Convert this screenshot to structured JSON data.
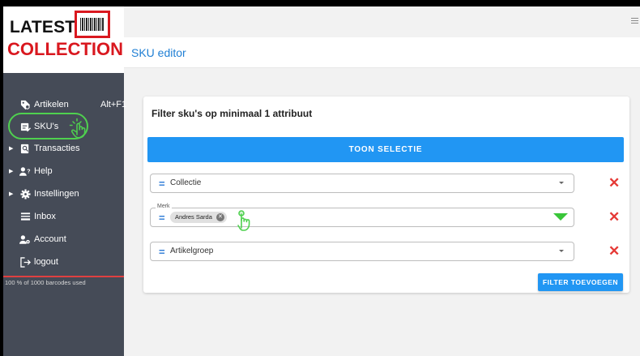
{
  "logo": {
    "line1": "LATEST",
    "line2": "COLLECTION"
  },
  "header": {
    "page_title": "SKU editor"
  },
  "sidebar": {
    "items": [
      {
        "label": "Artikelen",
        "shortcut": "Alt+F1",
        "icon": "tag-search-icon",
        "expandable": false
      },
      {
        "label": "SKU's",
        "icon": "sku-edit-icon",
        "expandable": false,
        "highlighted": true
      },
      {
        "label": "Transacties",
        "icon": "receipt-search-icon",
        "expandable": true
      },
      {
        "label": "Help",
        "icon": "help-person-icon",
        "expandable": true
      },
      {
        "label": "Instellingen",
        "icon": "gear-icon",
        "expandable": true
      },
      {
        "label": "Inbox",
        "icon": "inbox-icon",
        "expandable": false
      },
      {
        "label": "Account",
        "icon": "account-gear-icon",
        "expandable": false
      },
      {
        "label": "logout",
        "icon": "logout-icon",
        "expandable": false
      }
    ],
    "barcodes_used": "100 % of 1000 barcodes used"
  },
  "filter_card": {
    "title": "Filter sku's op minimaal 1 attribuut",
    "show_button": "TOON SELECTIE",
    "add_filter_button": "FILTER TOEVOEGEN",
    "filters": [
      {
        "value": "Collectie",
        "label": ""
      },
      {
        "label": "Merk",
        "chip": "Andres Sarda"
      },
      {
        "value": "Artikelgroep",
        "label": ""
      }
    ]
  },
  "colors": {
    "accent": "#2196f3",
    "brand_red": "#d9181f",
    "sidebar_bg": "#454b57",
    "highlight_green": "#4fd14f",
    "delete_red": "#e53935"
  }
}
